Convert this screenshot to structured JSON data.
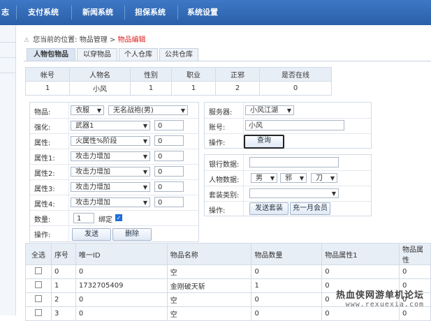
{
  "nav": {
    "items": [
      "志",
      "支付系统",
      "新闻系统",
      "担保系统",
      "系统设置"
    ]
  },
  "breadcrumb": {
    "prefix": "您当前的位置:",
    "path": "物品管理 >",
    "current": "物品编辑"
  },
  "tabs": [
    "人物包物品",
    "以穿物品",
    "个人仓库",
    "公共仓库"
  ],
  "char_table": {
    "headers": [
      "帐号",
      "人物名",
      "性别",
      "职业",
      "正邪",
      "是否在线"
    ],
    "row": [
      "1",
      "小风",
      "1",
      "1",
      "2",
      "0"
    ]
  },
  "item_form": {
    "item_label": "物品:",
    "item_type": "衣服",
    "item_name": "无名战袍(男)",
    "enhance_label": "强化:",
    "enhance_value": "武器1",
    "enhance_num": "0",
    "attr_label": "属性:",
    "attr_value": "火属性%阶段",
    "attr_num": "0",
    "attr_rows": [
      {
        "label": "属性1:",
        "value": "攻击力增加",
        "num": "0"
      },
      {
        "label": "属性2:",
        "value": "攻击力增加",
        "num": "0"
      },
      {
        "label": "属性3:",
        "value": "攻击力增加",
        "num": "0"
      },
      {
        "label": "属性4:",
        "value": "攻击力增加",
        "num": "0"
      }
    ],
    "qty_label": "数量:",
    "qty_value": "1",
    "bind_label": "绑定",
    "op_label": "操作:",
    "send_button": "发送",
    "delete_button": "删除"
  },
  "server_form": {
    "server_label": "服务器:",
    "server_value": "小风江湖",
    "account_label": "账号:",
    "account_value": "小风",
    "op_label": "操作:",
    "query_button": "查询"
  },
  "data_form": {
    "bank_label": "银行数据:",
    "bank_value": "",
    "char_label": "人物数据:",
    "gender": "男",
    "alignment": "邪",
    "weapon": "刀",
    "set_label": "套装类别:",
    "set_value": "",
    "op_label": "操作:",
    "send_set_button": "发送套装",
    "member_button": "充一月会员"
  },
  "items_table": {
    "headers": [
      "全选",
      "序号",
      "唯一ID",
      "物品名称",
      "物品数量",
      "物品属性1",
      "物品属性"
    ],
    "rows": [
      [
        "0",
        "0",
        "空",
        "0",
        "0",
        "0"
      ],
      [
        "1",
        "1732705409",
        "金刚破天斩",
        "1",
        "0",
        "0"
      ],
      [
        "2",
        "0",
        "空",
        "0",
        "0",
        "0"
      ],
      [
        "3",
        "0",
        "空",
        "0",
        "0",
        "0"
      ]
    ]
  },
  "watermark": {
    "line1": "热血侠网游单机论坛",
    "line2": "www.rexuexia.com"
  }
}
